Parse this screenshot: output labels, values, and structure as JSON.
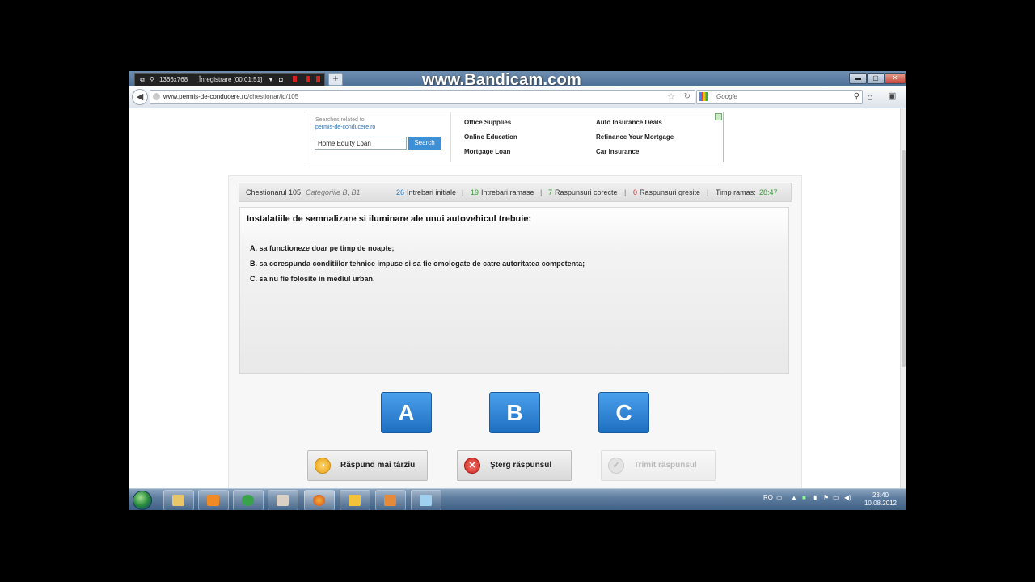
{
  "recorder": {
    "resolution": "1366x768",
    "status": "Înregistrare [00:01:51]",
    "watermark": "www.Bandicam.com"
  },
  "browser": {
    "url_domain": "www.permis-de-conducere.ro",
    "url_path": "/chestionar/id/105",
    "search_placeholder": "Google",
    "new_tab": "+"
  },
  "ad": {
    "searches_label": "Searches related to",
    "site": "permis-de-conducere.ro",
    "input_value": "Home Equity Loan",
    "search_button": "Search",
    "links_col1": [
      "Office Supplies",
      "Online Education",
      "Mortgage Loan"
    ],
    "links_col2": [
      "Auto Insurance Deals",
      "Refinance Your Mortgage",
      "Car Insurance"
    ]
  },
  "quiz": {
    "title": "Chestionarul 105",
    "category": "Categoriile B, B1",
    "initial_count": "26",
    "initial_label": "Intrebari initiale",
    "remaining_count": "19",
    "remaining_label": "Intrebari ramase",
    "correct_count": "7",
    "correct_label": "Raspunsuri corecte",
    "wrong_count": "0",
    "wrong_label": "Raspunsuri gresite",
    "time_label": "Timp ramas:",
    "time_value": "28:47",
    "question": "Instalatiile de semnalizare si iluminare ale unui autovehicul trebuie:",
    "answers": [
      {
        "letter": "A.",
        "text": "sa functioneze doar pe timp de noapte;"
      },
      {
        "letter": "B.",
        "text": "sa corespunda conditiilor tehnice impuse si sa fie omologate de catre autoritatea competenta;"
      },
      {
        "letter": "C.",
        "text": "sa nu fie folosite in mediul urban."
      }
    ],
    "choice_buttons": [
      "A",
      "B",
      "C"
    ],
    "later_button": "Răspund mai târziu",
    "delete_button": "Şterg răspunsul",
    "send_button": "Trimit răspunsul"
  },
  "taskbar": {
    "language": "RO",
    "time": "23:40",
    "date": "10.08.2012"
  },
  "colors": {
    "answer_button": "#2f86d8",
    "count_blue": "#2a7cc7",
    "count_green": "#3b9a3b",
    "count_red": "#c93333"
  }
}
